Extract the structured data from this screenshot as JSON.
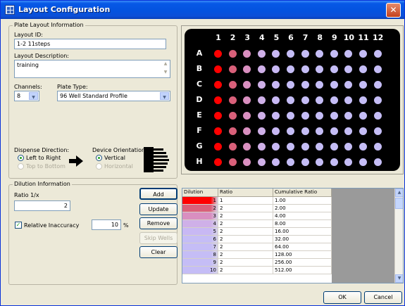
{
  "window": {
    "title": "Layout Configuration",
    "close_glyph": "✕"
  },
  "plate_layout": {
    "group_label": "Plate Layout Information",
    "layout_id_label": "Layout ID:",
    "layout_id_value": "1-2 11steps",
    "layout_description_label": "Layout Description:",
    "layout_description_value": "training",
    "channels_label": "Channels:",
    "channels_value": "8",
    "plate_type_label": "Plate Type:",
    "plate_type_value": "96 Well Standard Profile",
    "dispense_direction_label": "Dispense Direction:",
    "dispense_options": [
      "Left to Right",
      "Top to Bottom"
    ],
    "dispense_selected": "Left to Right",
    "device_orientation_label": "Device Orientation:",
    "orientation_options": [
      "Vertical",
      "Horizontal"
    ],
    "orientation_selected": "Vertical"
  },
  "plate": {
    "columns": [
      "1",
      "2",
      "3",
      "4",
      "5",
      "6",
      "7",
      "8",
      "9",
      "10",
      "11",
      "12"
    ],
    "rows": [
      "A",
      "B",
      "C",
      "D",
      "E",
      "F",
      "G",
      "H"
    ],
    "column_colors": [
      "#ff0000",
      "#d9607a",
      "#d98fc0",
      "#cfb0e8",
      "#c8b8f4",
      "#c5bdf6",
      "#c5bdf6",
      "#c5bdf6",
      "#c5bdf6",
      "#c5bdf6",
      "#c5bdf6",
      "#c5bdf6"
    ]
  },
  "dilution": {
    "group_label": "Dilution Information",
    "ratio_label": "Ratio 1/x",
    "ratio_value": "2",
    "relative_inaccuracy_label": "Relative Inaccuracy",
    "relative_inaccuracy_checked": true,
    "relative_inaccuracy_value": "10",
    "percent_label": "%",
    "buttons": {
      "add": "Add",
      "update": "Update",
      "remove": "Remove",
      "skip_wells": "Skip Wells",
      "clear": "Clear"
    },
    "table": {
      "headers": [
        "Dilution",
        "Ratio",
        "Cumulative Ratio"
      ],
      "rows": [
        {
          "dilution": "1",
          "color": "#ff0000",
          "ratio": "1",
          "cumulative": "1.00"
        },
        {
          "dilution": "2",
          "color": "#d9607a",
          "ratio": "2",
          "cumulative": "2.00"
        },
        {
          "dilution": "3",
          "color": "#d98fc0",
          "ratio": "2",
          "cumulative": "4.00"
        },
        {
          "dilution": "4",
          "color": "#cfb0e8",
          "ratio": "2",
          "cumulative": "8.00"
        },
        {
          "dilution": "5",
          "color": "#c8b8f4",
          "ratio": "2",
          "cumulative": "16.00"
        },
        {
          "dilution": "6",
          "color": "#c5bdf6",
          "ratio": "2",
          "cumulative": "32.00"
        },
        {
          "dilution": "7",
          "color": "#c5bdf6",
          "ratio": "2",
          "cumulative": "64.00"
        },
        {
          "dilution": "8",
          "color": "#c5bdf6",
          "ratio": "2",
          "cumulative": "128.00"
        },
        {
          "dilution": "9",
          "color": "#c5bdf6",
          "ratio": "2",
          "cumulative": "256.00"
        },
        {
          "dilution": "10",
          "color": "#c5bdf6",
          "ratio": "2",
          "cumulative": "512.00"
        }
      ]
    }
  },
  "footer": {
    "ok": "OK",
    "cancel": "Cancel"
  }
}
